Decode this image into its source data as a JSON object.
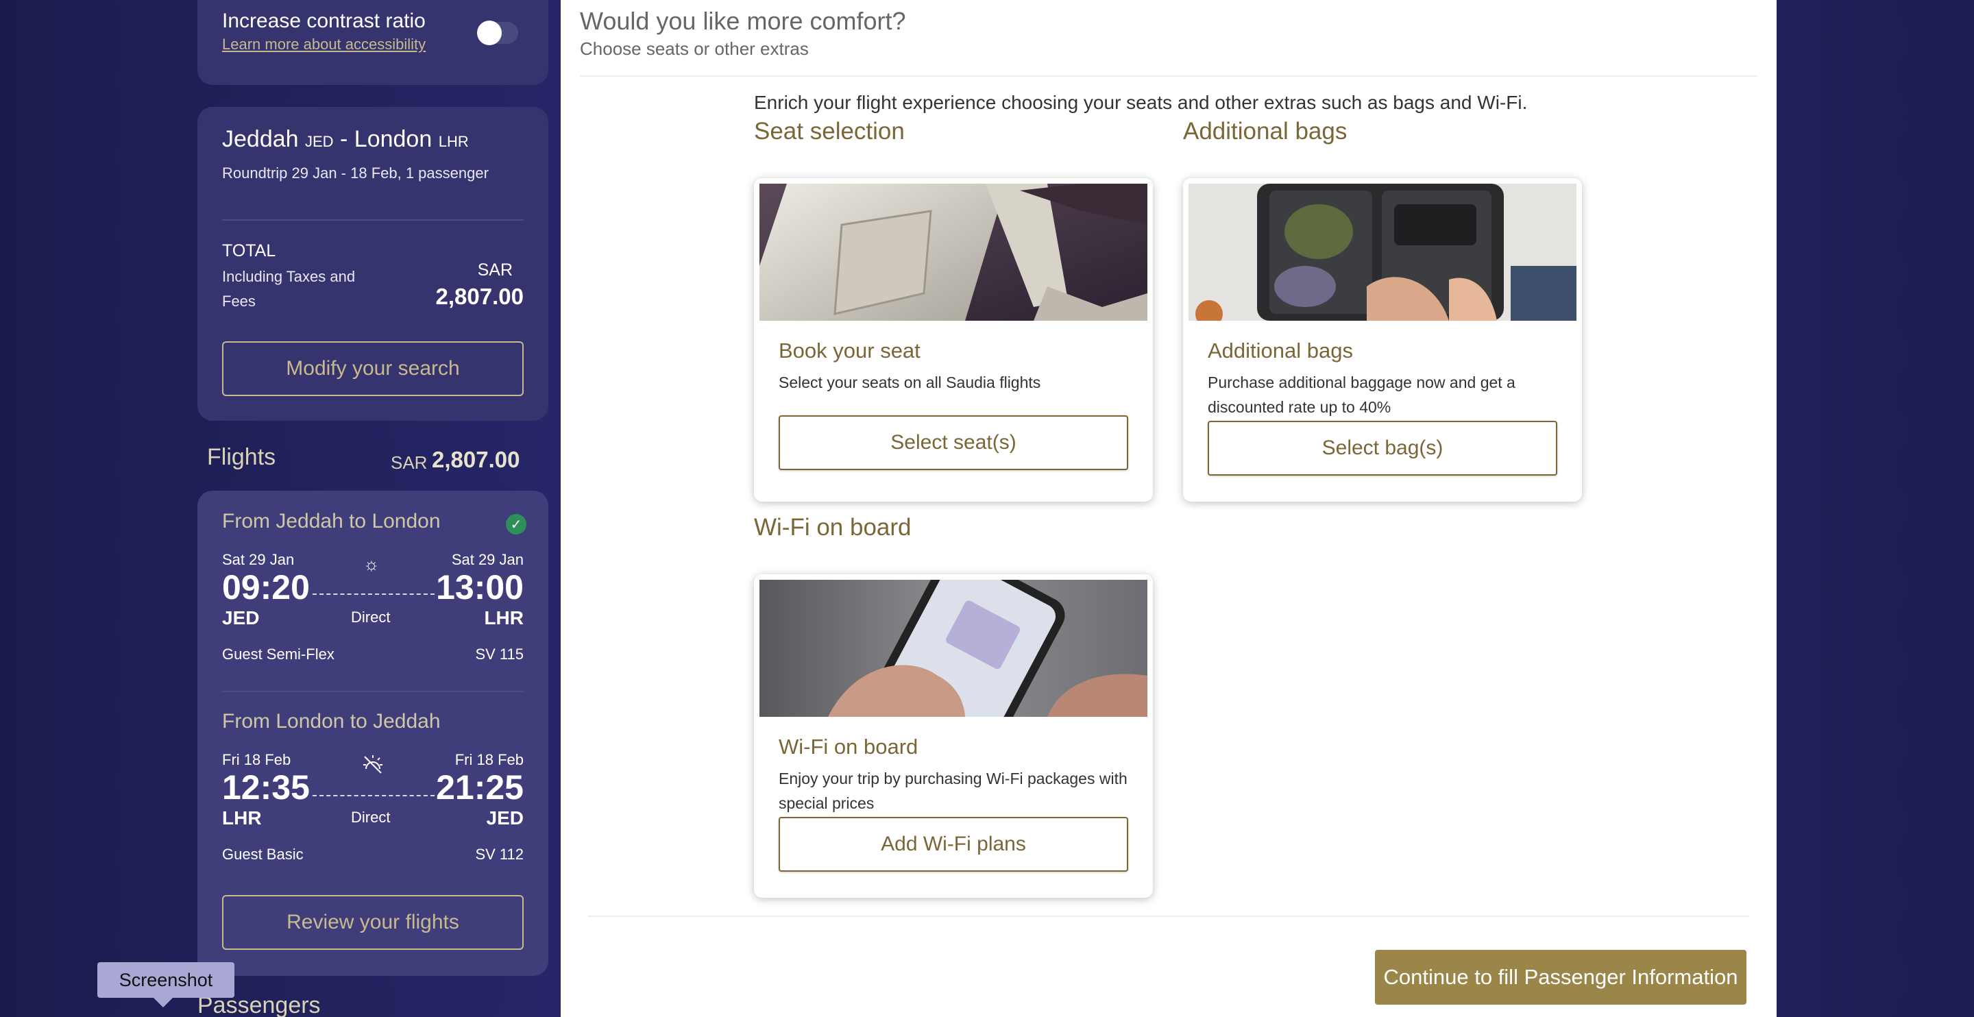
{
  "accessibility": {
    "title": "Increase contrast ratio",
    "link": "Learn more about accessibility",
    "toggle_on": false
  },
  "trip": {
    "origin_city": "Jeddah",
    "origin_code": "JED",
    "separator": "-",
    "dest_city": "London",
    "dest_code": "LHR",
    "summary": "Roundtrip 29 Jan - 18 Feb, 1 passenger",
    "total_label": "TOTAL",
    "total_sub": "Including Taxes and Fees",
    "currency": "SAR",
    "total_amount": "2,807.00",
    "modify_label": "Modify your search"
  },
  "flights": {
    "header": "Flights",
    "currency": "SAR",
    "amount": "2,807.00",
    "segments": [
      {
        "title": "From Jeddah to London",
        "dep_date": "Sat 29 Jan",
        "dep_time": "09:20",
        "dep_code": "JED",
        "arr_date": "Sat 29 Jan",
        "arr_time": "13:00",
        "arr_code": "LHR",
        "stops": "Direct",
        "fare": "Guest Semi-Flex",
        "flight_no": "SV 115",
        "time_of_day_icon": "sun-icon",
        "selected": true
      },
      {
        "title": "From London to Jeddah",
        "dep_date": "Fri 18 Feb",
        "dep_time": "12:35",
        "dep_code": "LHR",
        "arr_date": "Fri 18 Feb",
        "arr_time": "21:25",
        "arr_code": "JED",
        "stops": "Direct",
        "fare": "Guest Basic",
        "flight_no": "SV 112",
        "time_of_day_icon": "sunset-icon"
      }
    ],
    "review_label": "Review your flights"
  },
  "tooltip": "Screenshot",
  "passengers_header": "Passengers",
  "main": {
    "title": "Would you like more comfort?",
    "subtitle": "Choose seats or other extras",
    "intro": "Enrich your flight experience choosing your seats and other extras such as bags and Wi-Fi.",
    "sections": {
      "seat": {
        "heading": "Seat selection",
        "card_title": "Book your seat",
        "card_desc": "Select your seats on all Saudia flights",
        "button": "Select seat(s)"
      },
      "bags": {
        "heading": "Additional bags",
        "card_title": "Additional bags",
        "card_desc": "Purchase additional baggage now and get a discounted rate up to 40%",
        "button": "Select bag(s)"
      },
      "wifi": {
        "heading": "Wi-Fi on board",
        "card_title": "Wi-Fi on board",
        "card_desc": "Enjoy your trip by purchasing Wi-Fi packages with special prices",
        "button": "Add Wi-Fi plans"
      }
    },
    "continue_label": "Continue to fill Passenger Information"
  },
  "colors": {
    "accent_gold": "#7a6637",
    "button_gold": "#9b8649",
    "sidebar_bg": "#35346f",
    "success": "#2f8f5b"
  }
}
